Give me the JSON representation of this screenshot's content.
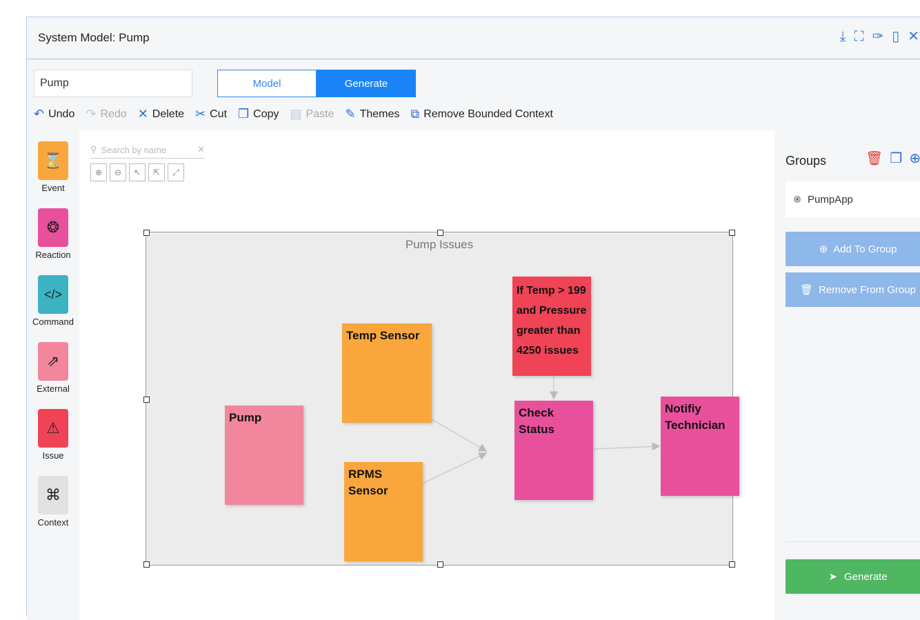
{
  "window": {
    "title": "System Model: Pump"
  },
  "header_icons": [
    "download-icon",
    "expand-icon",
    "pin-icon",
    "dock-icon",
    "close-icon"
  ],
  "model_name": {
    "value": "Pump"
  },
  "mode_toggle": {
    "model": "Model",
    "generate": "Generate",
    "active": "Generate"
  },
  "toolbar": {
    "undo": "Undo",
    "redo": "Redo",
    "delete": "Delete",
    "cut": "Cut",
    "copy": "Copy",
    "paste": "Paste",
    "themes": "Themes",
    "remove_context": "Remove Bounded Context"
  },
  "palette": [
    {
      "label": "Event",
      "color": "#f9a63d",
      "icon": "hourglass-icon"
    },
    {
      "label": "Reaction",
      "color": "#e9509b",
      "icon": "reaction-icon"
    },
    {
      "label": "Command",
      "color": "#3cb3c3",
      "icon": "code-icon"
    },
    {
      "label": "External",
      "color": "#f2869c",
      "icon": "external-link-icon"
    },
    {
      "label": "Issue",
      "color": "#f04356",
      "icon": "warning-icon"
    },
    {
      "label": "Context",
      "color": "#e2e2e2",
      "icon": "context-icon"
    }
  ],
  "search": {
    "placeholder": "Search by name"
  },
  "canvas": {
    "context_label": "Pump Issues",
    "notes": {
      "pump": "Pump",
      "temp_sensor": "Temp Sensor",
      "rpms_sensor": "RPMS Sensor",
      "issue": "If Temp > 199 and Pressure greater than 4250 issues",
      "check_status": "Check Status",
      "notify": "Notifiy Technician"
    }
  },
  "groups": {
    "title": "Groups",
    "items": [
      "PumpApp"
    ],
    "add_label": "Add To Group",
    "remove_label": "Remove From Group"
  },
  "generate_button": "Generate",
  "colors": {
    "event": "#f9a63d",
    "reaction": "#e9509b",
    "external": "#f2869c",
    "issue": "#f04356",
    "primary": "#1a84f6",
    "generate": "#4fb662"
  }
}
